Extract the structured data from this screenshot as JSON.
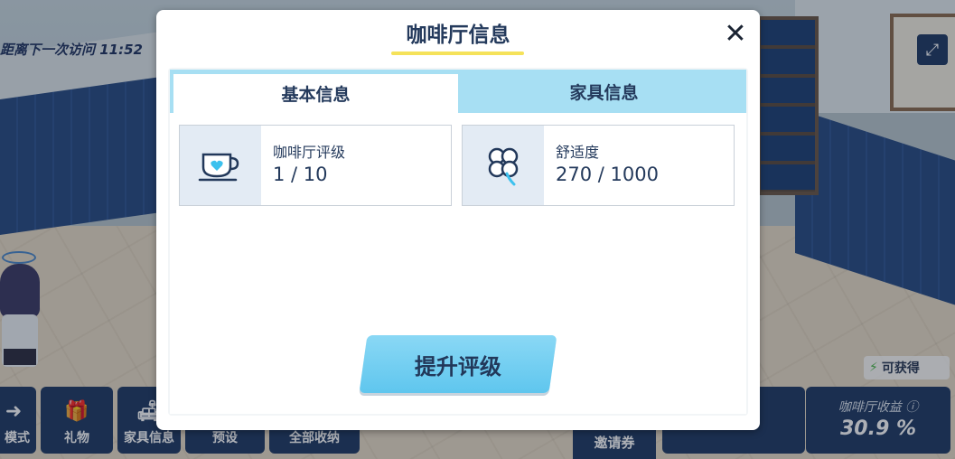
{
  "scene": {
    "visit_text": "距离下一次访问 11:52",
    "obtain_label": "可获得",
    "bottom_buttons": [
      {
        "label": "模式",
        "icon": "arrow-icon"
      },
      {
        "label": "礼物",
        "icon": "gift-icon"
      },
      {
        "label": "家具信息",
        "icon": "sofa-icon"
      },
      {
        "label": "预设",
        "icon": "preset-icon"
      },
      {
        "label": "全部收纳",
        "icon": "storage-icon"
      }
    ],
    "invite_label": "邀请券",
    "income_label": "咖啡厅收益 ⓘ",
    "income_value": "30.9 %"
  },
  "dialog": {
    "title": "咖啡厅信息",
    "close_glyph": "✕",
    "tabs": [
      {
        "label": "基本信息",
        "active": true
      },
      {
        "label": "家具信息",
        "active": false
      }
    ],
    "cards": [
      {
        "label": "咖啡厅评级",
        "value": "1 / 10",
        "icon": "coffee-cup-icon"
      },
      {
        "label": "舒适度",
        "value": "270 / 1000",
        "icon": "clover-icon"
      }
    ],
    "upgrade_label": "提升评级"
  },
  "colors": {
    "accent_blue": "#5fc6ee",
    "tab_bar": "#a7dff3",
    "title_underline": "#f5e25a",
    "text_dark": "#243a5c",
    "heart": "#3cc1ee"
  }
}
